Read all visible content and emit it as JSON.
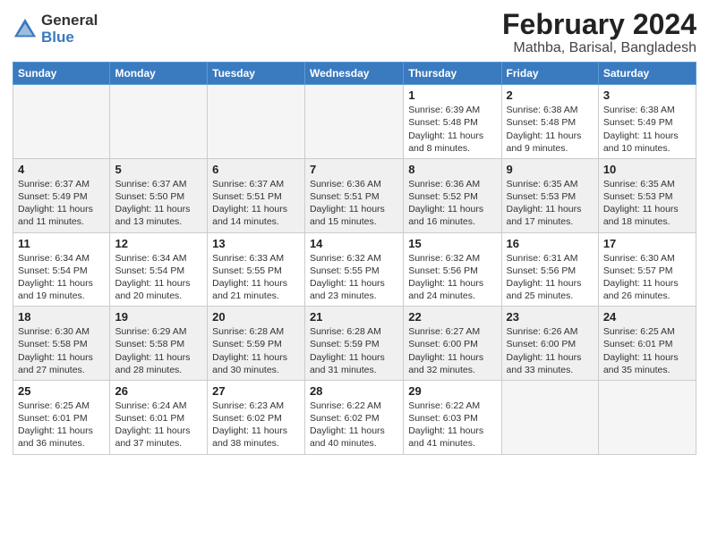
{
  "logo": {
    "general": "General",
    "blue": "Blue"
  },
  "header": {
    "month": "February 2024",
    "location": "Mathba, Barisal, Bangladesh"
  },
  "weekdays": [
    "Sunday",
    "Monday",
    "Tuesday",
    "Wednesday",
    "Thursday",
    "Friday",
    "Saturday"
  ],
  "weeks": [
    [
      {
        "day": "",
        "info": ""
      },
      {
        "day": "",
        "info": ""
      },
      {
        "day": "",
        "info": ""
      },
      {
        "day": "",
        "info": ""
      },
      {
        "day": "1",
        "info": "Sunrise: 6:39 AM\nSunset: 5:48 PM\nDaylight: 11 hours\nand 8 minutes."
      },
      {
        "day": "2",
        "info": "Sunrise: 6:38 AM\nSunset: 5:48 PM\nDaylight: 11 hours\nand 9 minutes."
      },
      {
        "day": "3",
        "info": "Sunrise: 6:38 AM\nSunset: 5:49 PM\nDaylight: 11 hours\nand 10 minutes."
      }
    ],
    [
      {
        "day": "4",
        "info": "Sunrise: 6:37 AM\nSunset: 5:49 PM\nDaylight: 11 hours\nand 11 minutes."
      },
      {
        "day": "5",
        "info": "Sunrise: 6:37 AM\nSunset: 5:50 PM\nDaylight: 11 hours\nand 13 minutes."
      },
      {
        "day": "6",
        "info": "Sunrise: 6:37 AM\nSunset: 5:51 PM\nDaylight: 11 hours\nand 14 minutes."
      },
      {
        "day": "7",
        "info": "Sunrise: 6:36 AM\nSunset: 5:51 PM\nDaylight: 11 hours\nand 15 minutes."
      },
      {
        "day": "8",
        "info": "Sunrise: 6:36 AM\nSunset: 5:52 PM\nDaylight: 11 hours\nand 16 minutes."
      },
      {
        "day": "9",
        "info": "Sunrise: 6:35 AM\nSunset: 5:53 PM\nDaylight: 11 hours\nand 17 minutes."
      },
      {
        "day": "10",
        "info": "Sunrise: 6:35 AM\nSunset: 5:53 PM\nDaylight: 11 hours\nand 18 minutes."
      }
    ],
    [
      {
        "day": "11",
        "info": "Sunrise: 6:34 AM\nSunset: 5:54 PM\nDaylight: 11 hours\nand 19 minutes."
      },
      {
        "day": "12",
        "info": "Sunrise: 6:34 AM\nSunset: 5:54 PM\nDaylight: 11 hours\nand 20 minutes."
      },
      {
        "day": "13",
        "info": "Sunrise: 6:33 AM\nSunset: 5:55 PM\nDaylight: 11 hours\nand 21 minutes."
      },
      {
        "day": "14",
        "info": "Sunrise: 6:32 AM\nSunset: 5:55 PM\nDaylight: 11 hours\nand 23 minutes."
      },
      {
        "day": "15",
        "info": "Sunrise: 6:32 AM\nSunset: 5:56 PM\nDaylight: 11 hours\nand 24 minutes."
      },
      {
        "day": "16",
        "info": "Sunrise: 6:31 AM\nSunset: 5:56 PM\nDaylight: 11 hours\nand 25 minutes."
      },
      {
        "day": "17",
        "info": "Sunrise: 6:30 AM\nSunset: 5:57 PM\nDaylight: 11 hours\nand 26 minutes."
      }
    ],
    [
      {
        "day": "18",
        "info": "Sunrise: 6:30 AM\nSunset: 5:58 PM\nDaylight: 11 hours\nand 27 minutes."
      },
      {
        "day": "19",
        "info": "Sunrise: 6:29 AM\nSunset: 5:58 PM\nDaylight: 11 hours\nand 28 minutes."
      },
      {
        "day": "20",
        "info": "Sunrise: 6:28 AM\nSunset: 5:59 PM\nDaylight: 11 hours\nand 30 minutes."
      },
      {
        "day": "21",
        "info": "Sunrise: 6:28 AM\nSunset: 5:59 PM\nDaylight: 11 hours\nand 31 minutes."
      },
      {
        "day": "22",
        "info": "Sunrise: 6:27 AM\nSunset: 6:00 PM\nDaylight: 11 hours\nand 32 minutes."
      },
      {
        "day": "23",
        "info": "Sunrise: 6:26 AM\nSunset: 6:00 PM\nDaylight: 11 hours\nand 33 minutes."
      },
      {
        "day": "24",
        "info": "Sunrise: 6:25 AM\nSunset: 6:01 PM\nDaylight: 11 hours\nand 35 minutes."
      }
    ],
    [
      {
        "day": "25",
        "info": "Sunrise: 6:25 AM\nSunset: 6:01 PM\nDaylight: 11 hours\nand 36 minutes."
      },
      {
        "day": "26",
        "info": "Sunrise: 6:24 AM\nSunset: 6:01 PM\nDaylight: 11 hours\nand 37 minutes."
      },
      {
        "day": "27",
        "info": "Sunrise: 6:23 AM\nSunset: 6:02 PM\nDaylight: 11 hours\nand 38 minutes."
      },
      {
        "day": "28",
        "info": "Sunrise: 6:22 AM\nSunset: 6:02 PM\nDaylight: 11 hours\nand 40 minutes."
      },
      {
        "day": "29",
        "info": "Sunrise: 6:22 AM\nSunset: 6:03 PM\nDaylight: 11 hours\nand 41 minutes."
      },
      {
        "day": "",
        "info": ""
      },
      {
        "day": "",
        "info": ""
      }
    ]
  ]
}
